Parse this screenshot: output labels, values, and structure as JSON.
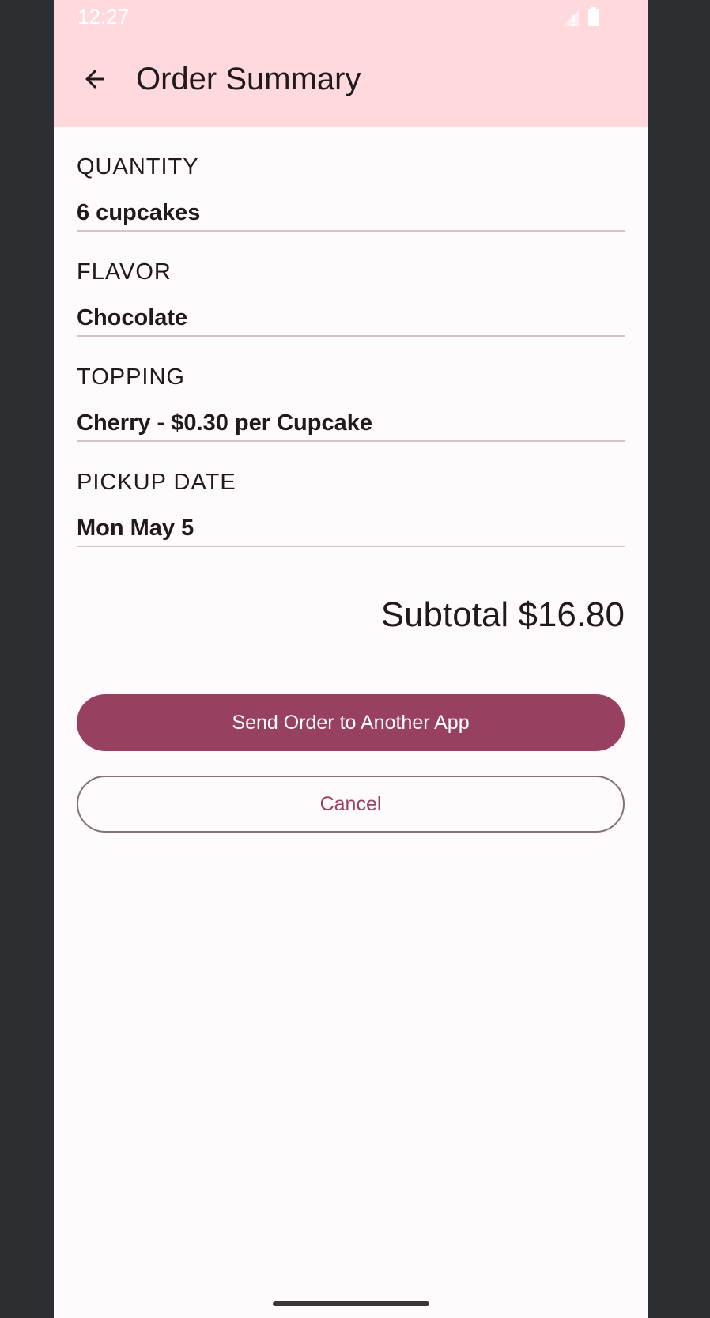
{
  "status_bar": {
    "time": "12:27",
    "icons": [
      "signal-icon",
      "battery-icon"
    ]
  },
  "app_bar": {
    "back_icon": "arrow-back-icon",
    "title": "Order Summary"
  },
  "summary": {
    "items": [
      {
        "label": "QUANTITY",
        "value": "6 cupcakes"
      },
      {
        "label": "FLAVOR",
        "value": "Chocolate"
      },
      {
        "label": "TOPPING",
        "value": "Cherry - $0.30 per Cupcake"
      },
      {
        "label": "PICKUP DATE",
        "value": "Mon May 5"
      }
    ],
    "subtotal": "Subtotal $16.80"
  },
  "actions": {
    "send_label": "Send Order to Another App",
    "cancel_label": "Cancel"
  },
  "colors": {
    "app_bar_bg": "#ffd9de",
    "primary": "#984061",
    "surface": "#fffbfd",
    "divider": "#d8c2c6",
    "outline": "#847376"
  }
}
